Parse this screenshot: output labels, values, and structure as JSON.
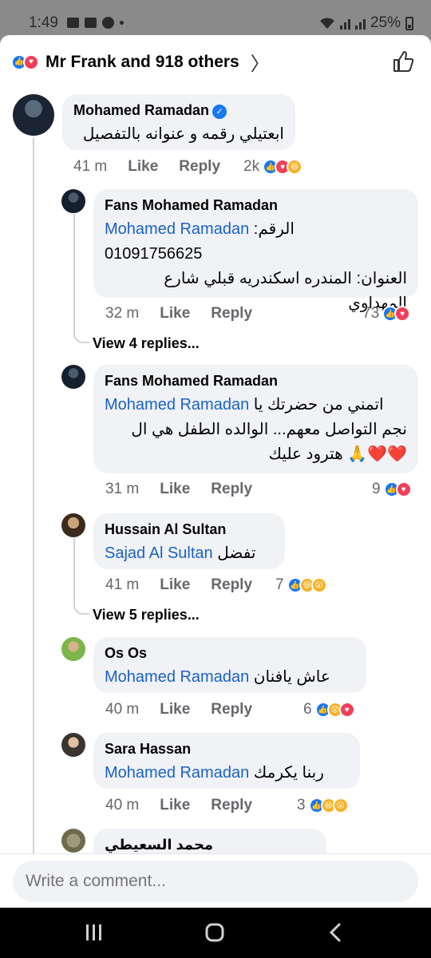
{
  "status_bar": {
    "time": "1:49",
    "battery": "25%"
  },
  "reactions_bar": {
    "text": "Mr Frank and 918 others",
    "icons": [
      "like",
      "love"
    ]
  },
  "comments": [
    {
      "author": "Mohamed Ramadan",
      "verified": true,
      "text": "ابعتيلي رقمه و عنوانه بالتفصيل",
      "time": "41 m",
      "like": "Like",
      "reply": "Reply",
      "reaction_count": "2k",
      "reaction_icons": [
        "like",
        "love",
        "haha"
      ]
    },
    {
      "author": "Fans Mohamed Ramadan",
      "mention": "Mohamed Ramadan",
      "line1": "الرقم:",
      "line2": "01091756625",
      "line3": "العنوان: المندره اسكندريه قبلي شارع المهداوي",
      "time": "32 m",
      "like": "Like",
      "reply": "Reply",
      "reaction_count": "73",
      "reaction_icons": [
        "like",
        "love"
      ],
      "view_replies": "View 4 replies..."
    },
    {
      "author": "Fans Mohamed Ramadan",
      "mention": "Mohamed Ramadan",
      "line1": "اتمني من حضرتك يا",
      "line2": "نجم التواصل معهم... الوالده الطفل هي ال",
      "line3": "❤️❤️🙏 هترود عليك",
      "time": "31 m",
      "like": "Like",
      "reply": "Reply",
      "reaction_count": "9",
      "reaction_icons": [
        "like",
        "love"
      ]
    },
    {
      "author": "Hussain Al Sultan",
      "mention": "Sajad Al Sultan",
      "text": "تفضل",
      "time": "41 m",
      "like": "Like",
      "reply": "Reply",
      "reaction_count": "7",
      "reaction_icons": [
        "like",
        "haha",
        "wow"
      ],
      "view_replies": "View 5 replies..."
    },
    {
      "author": "Os Os",
      "mention": "Mohamed Ramadan",
      "text": "عاش يافنان",
      "time": "40 m",
      "like": "Like",
      "reply": "Reply",
      "reaction_count": "6",
      "reaction_icons": [
        "like",
        "wow",
        "love"
      ]
    },
    {
      "author": "Sara Hassan",
      "mention": "Mohamed Ramadan",
      "text": "ربنا يكرمك",
      "time": "40 m",
      "like": "Like",
      "reply": "Reply",
      "reaction_count": "3",
      "reaction_icons": [
        "like",
        "haha",
        "wow"
      ]
    },
    {
      "author": "محمد السعيطي"
    }
  ],
  "composer": {
    "placeholder": "Write a comment..."
  },
  "nav": {
    "recent": "III",
    "home": "◯",
    "back": "‹"
  }
}
